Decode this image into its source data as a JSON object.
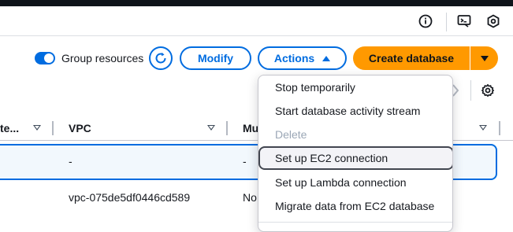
{
  "colors": {
    "accent": "#006ce0",
    "primary": "#ff9900",
    "topbar": "#0f141a",
    "disabled": "#9ba7b6"
  },
  "header_icons": [
    "info-icon",
    "cloudshell-icon",
    "settings-hex-icon"
  ],
  "toolbar": {
    "group_resources_label": "Group resources",
    "group_resources_on": true,
    "modify_label": "Modify",
    "actions_label": "Actions",
    "create_label": "Create database"
  },
  "table": {
    "headers": [
      "te...",
      "VPC",
      "Mu"
    ],
    "rows": [
      {
        "vpc": "-",
        "multi_az": "-"
      },
      {
        "vpc": "vpc-075de5df0446cd589",
        "multi_az": "No"
      }
    ]
  },
  "actions_menu": {
    "items": [
      {
        "label": "Stop temporarily",
        "disabled": false,
        "hovered": false
      },
      {
        "label": "Start database activity stream",
        "disabled": false,
        "hovered": false
      },
      {
        "label": "Delete",
        "disabled": true,
        "hovered": false
      },
      {
        "label": "Set up EC2 connection",
        "disabled": false,
        "hovered": true
      },
      {
        "label": "Set up Lambda connection",
        "disabled": false,
        "hovered": false
      },
      {
        "label": "Migrate data from EC2 database",
        "disabled": false,
        "hovered": false
      }
    ]
  }
}
